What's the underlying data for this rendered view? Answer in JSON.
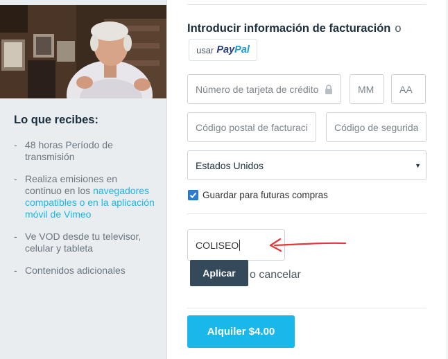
{
  "sidebar": {
    "heading": "Lo que recibes:",
    "benefits": [
      {
        "text": "48 horas Período de transmisión"
      },
      {
        "text_before": "Realiza emisiones en continuo en los ",
        "link": "navegadores compatibles o en la aplicación móvil de Vimeo"
      },
      {
        "text": "Ve VOD desde tu televisor, celular y tableta"
      },
      {
        "text": "Contenidos adicionales"
      }
    ]
  },
  "billing": {
    "title": "Introducir información de facturación",
    "or": "o",
    "paypal_prefix": "usar",
    "paypal_logo_pay": "Pay",
    "paypal_logo_pal": "Pal",
    "card_number_placeholder": "Número de tarjeta de crédito",
    "month_placeholder": "MM",
    "year_placeholder": "AA",
    "postal_placeholder": "Código postal de facturaci",
    "security_placeholder": "Código de segurida",
    "country": "Estados Unidos",
    "save_label": "Guardar para futuras compras",
    "save_checked": true
  },
  "coupon": {
    "value": "COLISEO",
    "apply_label": "Aplicar",
    "or_text": "o",
    "cancel_label": "cancelar"
  },
  "rent": {
    "label": "Alquiler $4.00"
  },
  "colors": {
    "accent": "#1ab7ea",
    "apply": "#34495a",
    "arrow": "#e03a3a"
  }
}
